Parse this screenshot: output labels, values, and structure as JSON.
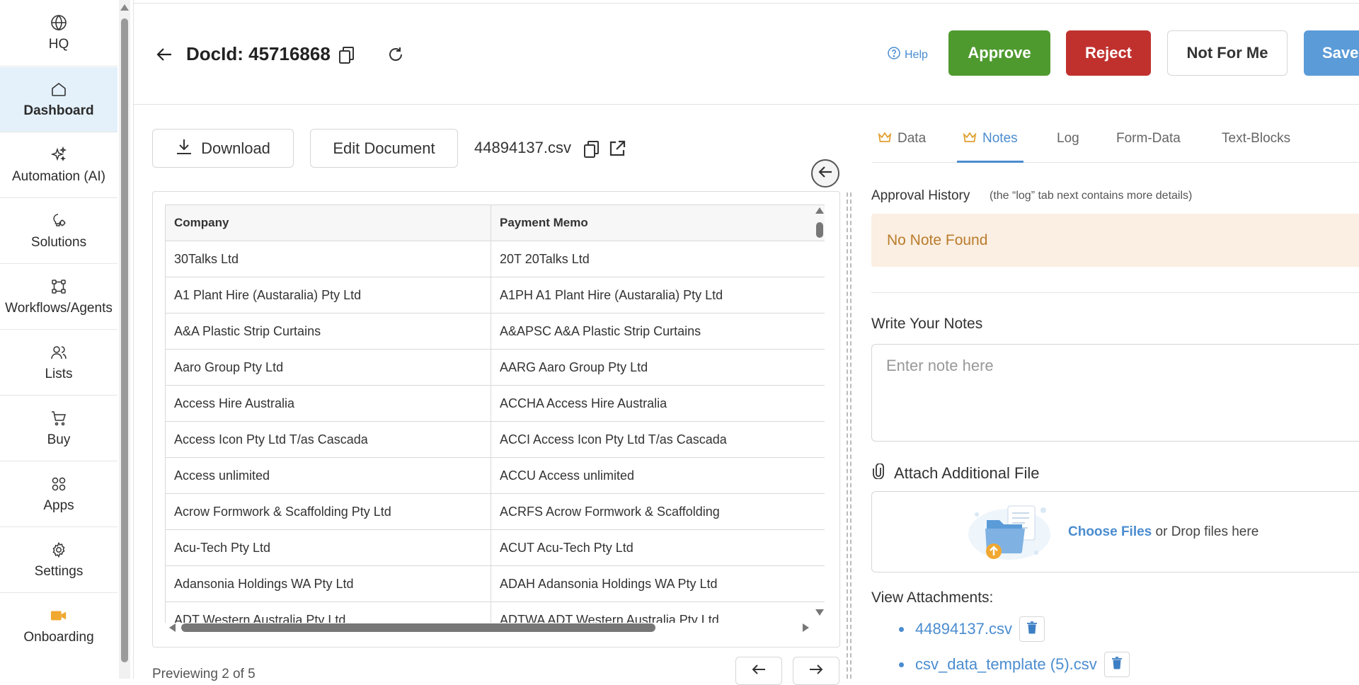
{
  "sidebar": {
    "items": [
      {
        "label": "HQ",
        "icon": "globe-icon"
      },
      {
        "label": "Dashboard",
        "icon": "home-icon",
        "active": true
      },
      {
        "label": "Automation (AI)",
        "icon": "sparkles-icon"
      },
      {
        "label": "Solutions",
        "icon": "lightbulb-gear-icon"
      },
      {
        "label": "Workflows/Agents",
        "icon": "workflow-icon"
      },
      {
        "label": "Lists",
        "icon": "users-icon"
      },
      {
        "label": "Buy",
        "icon": "cart-icon"
      },
      {
        "label": "Apps",
        "icon": "apps-grid-icon"
      },
      {
        "label": "Settings",
        "icon": "gear-icon"
      },
      {
        "label": "Onboarding",
        "icon": "video-camera-icon"
      }
    ]
  },
  "header": {
    "doc_title": "DocId: 45716868",
    "help_label": "Help",
    "approve_label": "Approve",
    "reject_label": "Reject",
    "not_for_me_label": "Not For Me",
    "save_label": "Save"
  },
  "document": {
    "download_label": "Download",
    "edit_label": "Edit Document",
    "file_name": "44894137.csv",
    "preview_text": "Previewing 2 of 5",
    "table": {
      "columns": [
        "Company",
        "Payment Memo"
      ],
      "rows": [
        [
          "30Talks Ltd",
          "20T 20Talks Ltd"
        ],
        [
          "A1 Plant Hire (Austaralia) Pty Ltd",
          "A1PH A1 Plant Hire (Austaralia) Pty Ltd"
        ],
        [
          "A&A Plastic Strip Curtains",
          "A&APSC A&A Plastic Strip Curtains"
        ],
        [
          "Aaro Group Pty Ltd",
          "AARG Aaro Group Pty Ltd"
        ],
        [
          "Access Hire Australia",
          "ACCHA Access Hire Australia"
        ],
        [
          "Access Icon Pty Ltd T/as Cascada",
          "ACCI Access Icon Pty Ltd T/as Cascada"
        ],
        [
          "Access unlimited",
          "ACCU Access unlimited"
        ],
        [
          "Acrow Formwork & Scaffolding Pty Ltd",
          "ACRFS Acrow Formwork & Scaffolding"
        ],
        [
          "Acu-Tech Pty Ltd",
          "ACUT Acu-Tech Pty Ltd"
        ],
        [
          "Adansonia Holdings WA Pty Ltd",
          "ADAH Adansonia Holdings WA Pty Ltd"
        ],
        [
          "ADT Western Australia Pty Ltd",
          "ADTWA ADT Western Australia Pty Ltd"
        ]
      ]
    }
  },
  "panel": {
    "tabs": [
      {
        "label": "Data",
        "icon": "crown-icon"
      },
      {
        "label": "Notes",
        "icon": "crown-icon",
        "active": true
      },
      {
        "label": "Log"
      },
      {
        "label": "Form-Data"
      },
      {
        "label": "Text-Blocks"
      }
    ],
    "approval_title": "Approval History",
    "approval_sub": "(the “log” tab next contains more details)",
    "no_note": "No Note Found",
    "notes_title": "Write Your Notes",
    "notes_placeholder": "Enter note here",
    "notes_value": "",
    "attach_title": "Attach Additional File",
    "choose_files": "Choose Files",
    "drop_text": " or Drop files here",
    "view_attachments_title": "View Attachments:",
    "attachments": [
      "44894137.csv",
      "csv_data_template (5).csv"
    ]
  },
  "colors": {
    "approve": "#4f9a2f",
    "reject": "#c0312e",
    "save": "#5b9bd8",
    "accent": "#4a8ccf",
    "active_nav": "#e4f1fb",
    "no_note_bg": "#fbeee2",
    "no_note_text": "#b97c2c",
    "onboarding_icon": "#f0a830"
  }
}
